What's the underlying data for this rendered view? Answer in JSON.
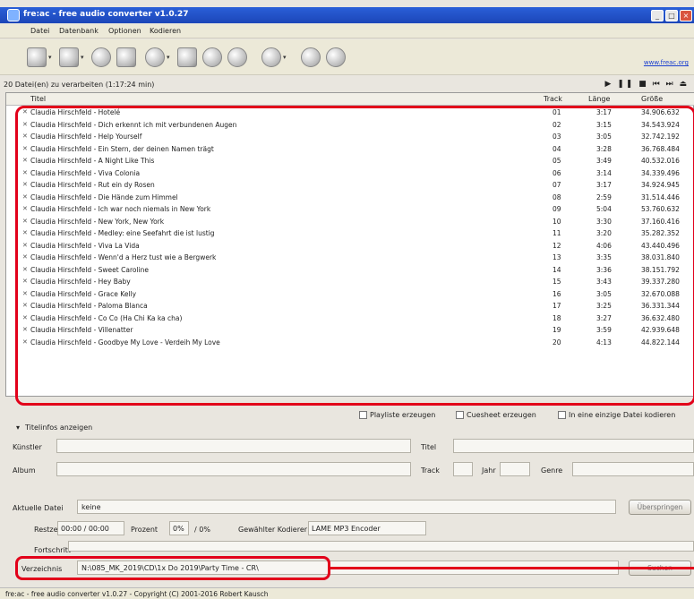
{
  "window": {
    "title": "fre:ac - free audio converter v1.0.27",
    "controls": [
      "_",
      "□",
      "×"
    ]
  },
  "menu": [
    "Datei",
    "Datenbank",
    "Optionen",
    "Kodieren"
  ],
  "website": "www.freac.org",
  "list_info": "20 Datei(en) zu verarbeiten (1:17:24 min)",
  "transport": "▶ ❚❚ ■ ⏮ ⏭ ⏏",
  "columns": {
    "title": "Titel",
    "track": "Track",
    "length": "Länge",
    "size": "Größe"
  },
  "tracks": [
    {
      "title": "Claudia Hirschfeld - Hotelé",
      "track": "01",
      "length": "3:17",
      "size": "34.906.632"
    },
    {
      "title": "Claudia Hirschfeld - Dich erkennt ich mit verbundenen Augen",
      "track": "02",
      "length": "3:15",
      "size": "34.543.924"
    },
    {
      "title": "Claudia Hirschfeld - Help Yourself",
      "track": "03",
      "length": "3:05",
      "size": "32.742.192"
    },
    {
      "title": "Claudia Hirschfeld - Ein Stern, der deinen Namen trägt",
      "track": "04",
      "length": "3:28",
      "size": "36.768.484"
    },
    {
      "title": "Claudia Hirschfeld - A Night Like This",
      "track": "05",
      "length": "3:49",
      "size": "40.532.016"
    },
    {
      "title": "Claudia Hirschfeld - Viva Colonia",
      "track": "06",
      "length": "3:14",
      "size": "34.339.496"
    },
    {
      "title": "Claudia Hirschfeld - Rut ein dy Rosen",
      "track": "07",
      "length": "3:17",
      "size": "34.924.945"
    },
    {
      "title": "Claudia Hirschfeld - Die Hände zum Himmel",
      "track": "08",
      "length": "2:59",
      "size": "31.514.446"
    },
    {
      "title": "Claudia Hirschfeld - Ich war noch niemals in New York",
      "track": "09",
      "length": "5:04",
      "size": "53.760.632"
    },
    {
      "title": "Claudia Hirschfeld - New York, New York",
      "track": "10",
      "length": "3:30",
      "size": "37.160.416"
    },
    {
      "title": "Claudia Hirschfeld - Medley: eine Seefahrt die ist lustig",
      "track": "11",
      "length": "3:20",
      "size": "35.282.352"
    },
    {
      "title": "Claudia Hirschfeld - Viva La Vida",
      "track": "12",
      "length": "4:06",
      "size": "43.440.496"
    },
    {
      "title": "Claudia Hirschfeld - Wenn'd a Herz tust wie a Bergwerk",
      "track": "13",
      "length": "3:35",
      "size": "38.031.840"
    },
    {
      "title": "Claudia Hirschfeld - Sweet Caroline",
      "track": "14",
      "length": "3:36",
      "size": "38.151.792"
    },
    {
      "title": "Claudia Hirschfeld - Hey Baby",
      "track": "15",
      "length": "3:43",
      "size": "39.337.280"
    },
    {
      "title": "Claudia Hirschfeld - Grace Kelly",
      "track": "16",
      "length": "3:05",
      "size": "32.670.088"
    },
    {
      "title": "Claudia Hirschfeld - Paloma Blanca",
      "track": "17",
      "length": "3:25",
      "size": "36.331.344"
    },
    {
      "title": "Claudia Hirschfeld - Co Co (Ha Chi Ka ka cha)",
      "track": "18",
      "length": "3:27",
      "size": "36.632.480"
    },
    {
      "title": "Claudia Hirschfeld - Villenatter",
      "track": "19",
      "length": "3:59",
      "size": "42.939.648"
    },
    {
      "title": "Claudia Hirschfeld - Goodbye My Love - Verdeih My Love",
      "track": "20",
      "length": "4:13",
      "size": "44.822.144"
    }
  ],
  "options": {
    "playlist": "Playliste erzeugen",
    "cuesheet": "Cuesheet erzeugen",
    "single_file": "In eine einzige Datei kodieren"
  },
  "tag_section": {
    "toggle": "Titelinfos anzeigen",
    "artist": "Künstler",
    "title": "Titel",
    "album": "Album",
    "track": "Track",
    "year": "Jahr",
    "genre": "Genre"
  },
  "progress": {
    "current_file_label": "Aktuelle Datei",
    "current_file_value": "keine",
    "time_label": "Restzeit",
    "time_value": "00:00 / 00:00",
    "percent_label": "Prozent",
    "percent_value": "0%",
    "percent_total": "/ 0%",
    "encoder_label": "Gewählter Kodierer",
    "encoder_value": "LAME MP3 Encoder",
    "progress_label": "Fortschritt",
    "skip_button": "Überspringen"
  },
  "output": {
    "label": "Verzeichnis",
    "value": "N:\\085_MK_2019\\CD\\1x Do 2019\\Party Time - CR\\",
    "browse_button": "Suchen"
  },
  "statusbar": "fre:ac - free audio converter v1.0.27 - Copyright (C) 2001-2016 Robert Kausch"
}
